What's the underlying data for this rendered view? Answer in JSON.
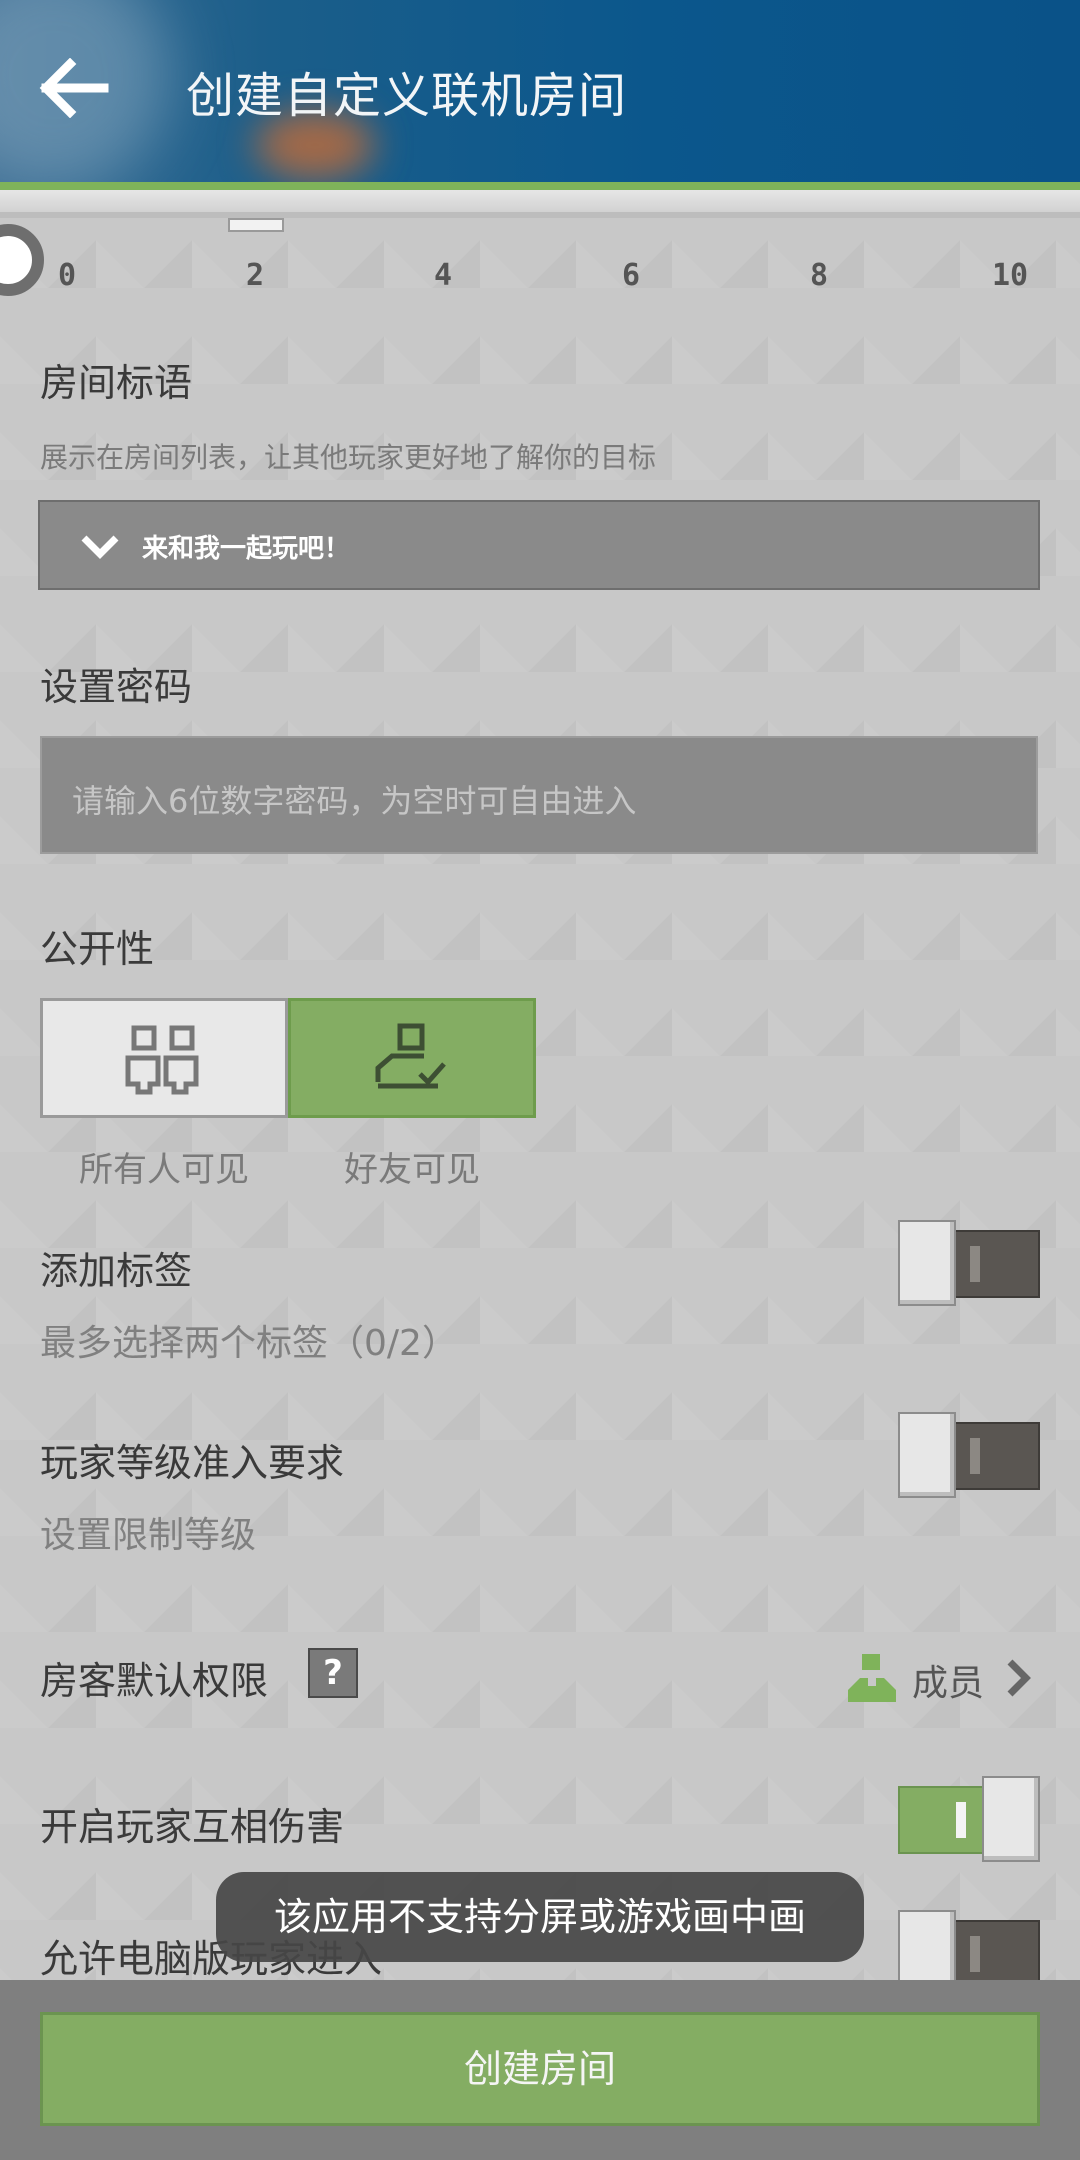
{
  "header": {
    "title": "创建自定义联机房间"
  },
  "slider": {
    "ticks": [
      "0",
      "2",
      "4",
      "6",
      "8",
      "10"
    ],
    "value": 0
  },
  "room_slogan": {
    "label": "房间标语",
    "hint": "展示在房间列表，让其他玩家更好地了解你的目标",
    "selected": "来和我一起玩吧！"
  },
  "password": {
    "label": "设置密码",
    "placeholder": "请输入6位数字密码，为空时可自由进入"
  },
  "visibility": {
    "label": "公开性",
    "options": [
      {
        "label": "所有人可见",
        "selected": false
      },
      {
        "label": "好友可见",
        "selected": true
      }
    ]
  },
  "tags": {
    "label": "添加标签",
    "hint": "最多选择两个标签（0/2）",
    "enabled": false
  },
  "level": {
    "label": "玩家等级准入要求",
    "hint": "设置限制等级",
    "enabled": false
  },
  "permission": {
    "label": "房客默认权限",
    "help": "?",
    "value": "成员"
  },
  "pvp": {
    "label": "开启玩家互相伤害",
    "enabled": true
  },
  "pc_join": {
    "label": "允许电脑版玩家进入",
    "enabled": false
  },
  "toast": {
    "text": "该应用不支持分屏或游戏画中画"
  },
  "footer": {
    "create_label": "创建房间"
  },
  "colors": {
    "accent": "#84ad63",
    "header": "#0b578c",
    "background": "#c8c8c8"
  }
}
